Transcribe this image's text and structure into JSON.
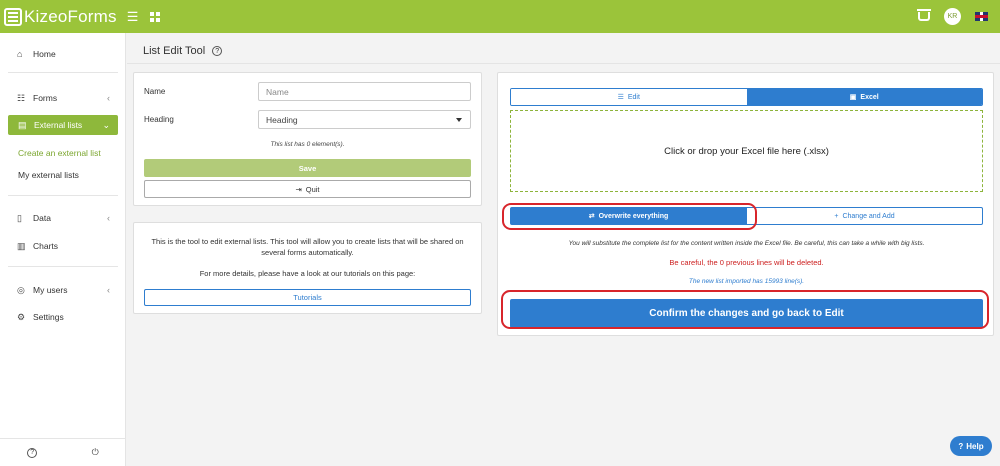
{
  "topbar": {
    "logo_part1": "Kizeo",
    "logo_part2": "Forms",
    "menu_icon": "hamburger-icon",
    "apps_icon": "grid-icon",
    "basket_icon": "basket-icon",
    "user_initials": "KR",
    "language_icon": "uk-flag-icon"
  },
  "sidebar": {
    "home": "Home",
    "forms": "Forms",
    "external_lists": "External lists",
    "create_external_list": "Create an external list",
    "my_external_lists": "My external lists",
    "data": "Data",
    "charts": "Charts",
    "my_users": "My users",
    "settings": "Settings",
    "help_glyph": "?",
    "power_glyph": "⏻"
  },
  "page": {
    "title": "List Edit Tool",
    "title_help_glyph": "?"
  },
  "form_panel": {
    "name_label": "Name",
    "name_placeholder": "Name",
    "heading_label": "Heading",
    "heading_value": "Heading",
    "count_text": "This list has 0 element(s).",
    "save_label": "Save",
    "quit_label": "Quit"
  },
  "info_panel": {
    "line1": "This is the tool to edit external lists. This tool will allow you to create lists that will be shared on several forms automatically.",
    "line2": "For more details, please have a look at our tutorials on this page:",
    "tutorials_label": "Tutorials"
  },
  "import_panel": {
    "tab_edit": "Edit",
    "tab_excel": "Excel",
    "active_tab": "Excel",
    "dropzone_text": "Click or drop your Excel file here (.xlsx)",
    "overwrite_label": "Overwrite everything",
    "change_add_label": "Change and Add",
    "selected_mode": "Overwrite everything",
    "substitute_text": "You will substitute the complete list for the content written inside the Excel file. Be careful, this can take a while with big lists.",
    "warning_text": "Be careful, the 0 previous lines will be deleted.",
    "imported_text": "The new list imported has 15993 line(s).",
    "confirm_label": "Confirm the changes and go back to Edit"
  },
  "help": {
    "label": "Help",
    "glyph": "?"
  },
  "colors": {
    "brand_green": "#9bc43a",
    "primary_blue": "#2e7dcf",
    "warning_red": "#cc1f1f",
    "highlight_ring": "#d8252b"
  }
}
